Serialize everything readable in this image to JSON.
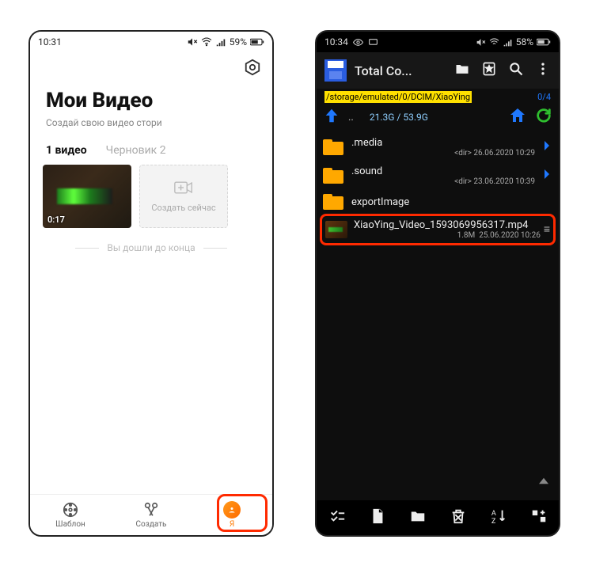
{
  "left": {
    "status": {
      "time": "10:31",
      "battery": "59%"
    },
    "title": "Мои Видео",
    "subtitle": "Создай свою видео стори",
    "tabs": [
      {
        "label": "1 видео",
        "active": true
      },
      {
        "label": "Черновик 2",
        "active": false
      }
    ],
    "video": {
      "duration": "0:17"
    },
    "create_now": "Создать сейчас",
    "end_text": "Вы дошли до конца",
    "nav": [
      {
        "label": "Шаблон",
        "icon": "reel-icon"
      },
      {
        "label": "Создать",
        "icon": "scissors-icon"
      },
      {
        "label": "Я",
        "icon": "me-icon",
        "highlight": true
      }
    ]
  },
  "right": {
    "status": {
      "time": "10:34",
      "battery": "58%"
    },
    "app_title": "Total Co...",
    "path": "/storage/emulated/0/DCIM/XiaoYing",
    "counter": "0/4",
    "storage": "21.3G / 53.9G",
    "files": [
      {
        "type": "folder",
        "name": ".media",
        "meta": "<dir>  26.06.2020  10:29"
      },
      {
        "type": "folder",
        "name": ".sound",
        "meta": "<dir>  23.06.2020  10:39"
      },
      {
        "type": "folder",
        "name": "exportImage",
        "meta": ""
      },
      {
        "type": "video",
        "name": "XiaoYing_Video_1593069956317.mp4",
        "size": "1.8M",
        "date": "25.06.2020  10:26",
        "highlight": true
      }
    ]
  }
}
